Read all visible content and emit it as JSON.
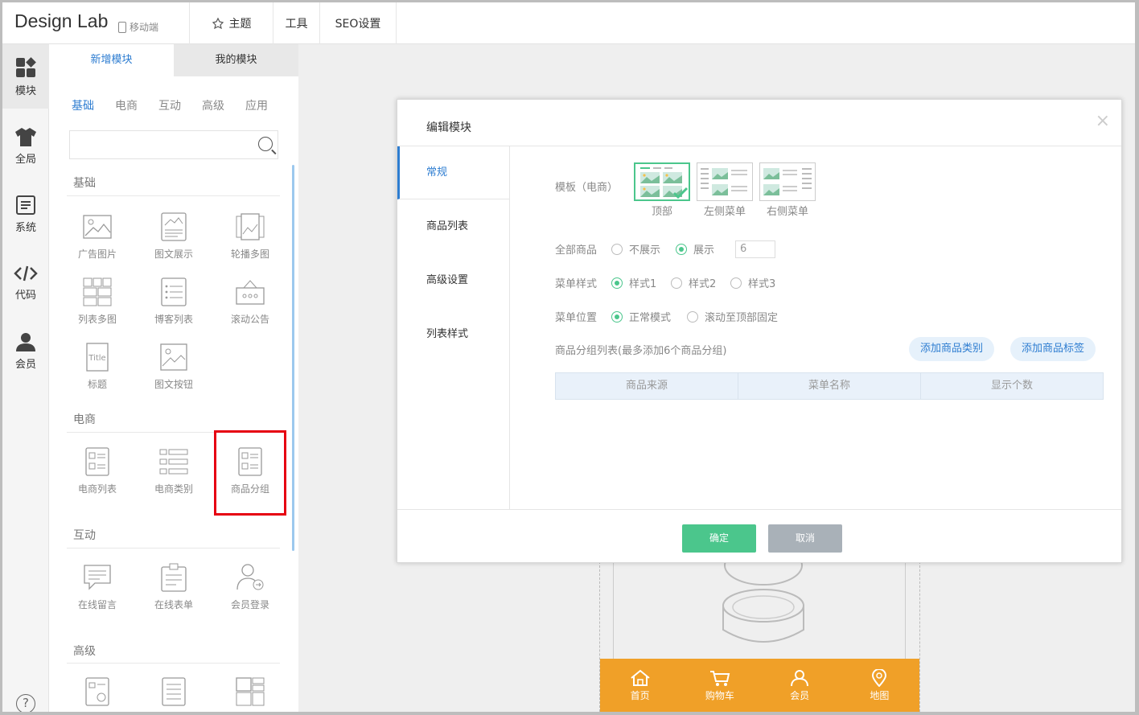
{
  "app": {
    "title": "Design Lab",
    "mode": "移动端"
  },
  "topnav": {
    "theme": "主题",
    "tools": "工具",
    "seo": "SEO设置"
  },
  "leftbar": [
    {
      "label": "模块",
      "icon": "modules-icon"
    },
    {
      "label": "全局",
      "icon": "shirt-icon"
    },
    {
      "label": "系统",
      "icon": "document-icon"
    },
    {
      "label": "代码",
      "icon": "code-icon"
    },
    {
      "label": "会员",
      "icon": "user-icon"
    }
  ],
  "help": "?",
  "panel": {
    "tabs": [
      "新增模块",
      "我的模块"
    ],
    "subtabs": [
      "基础",
      "电商",
      "互动",
      "高级",
      "应用"
    ],
    "search_placeholder": "",
    "sections": [
      {
        "title": "基础",
        "items": [
          "广告图片",
          "图文展示",
          "轮播多图",
          "列表多图",
          "博客列表",
          "滚动公告",
          "标题",
          "图文按钮"
        ]
      },
      {
        "title": "电商",
        "items": [
          "电商列表",
          "电商类别",
          "商品分组"
        ]
      },
      {
        "title": "互动",
        "items": [
          "在线留言",
          "在线表单",
          "会员登录"
        ]
      },
      {
        "title": "高级",
        "items": []
      }
    ],
    "title_glyph": "Title"
  },
  "phone": {
    "nav": [
      "首页",
      "购物车",
      "会员",
      "地图"
    ]
  },
  "modal": {
    "title": "编辑模块",
    "close": "×",
    "nav": [
      "常规",
      "商品列表",
      "高级设置",
      "列表样式"
    ],
    "template_label": "模板（电商）",
    "templates": [
      "顶部",
      "左侧菜单",
      "右侧菜单"
    ],
    "all_products": {
      "label": "全部商品",
      "options": [
        "不展示",
        "展示"
      ],
      "selected": "展示",
      "count": "6"
    },
    "menu_style": {
      "label": "菜单样式",
      "options": [
        "样式1",
        "样式2",
        "样式3"
      ],
      "selected": "样式1"
    },
    "menu_position": {
      "label": "菜单位置",
      "options": [
        "正常模式",
        "滚动至顶部固定"
      ],
      "selected": "正常模式"
    },
    "group_list_label": "商品分组列表(最多添加6个商品分组)",
    "add_category": "添加商品类别",
    "add_tag": "添加商品标签",
    "table_headers": [
      "商品来源",
      "菜单名称",
      "显示个数"
    ],
    "ok": "确定",
    "cancel": "取消"
  },
  "colors": {
    "accent_blue": "#2e7dd1",
    "green": "#4bc68c",
    "orange": "#f0a028",
    "highlight_red": "#e60012"
  }
}
